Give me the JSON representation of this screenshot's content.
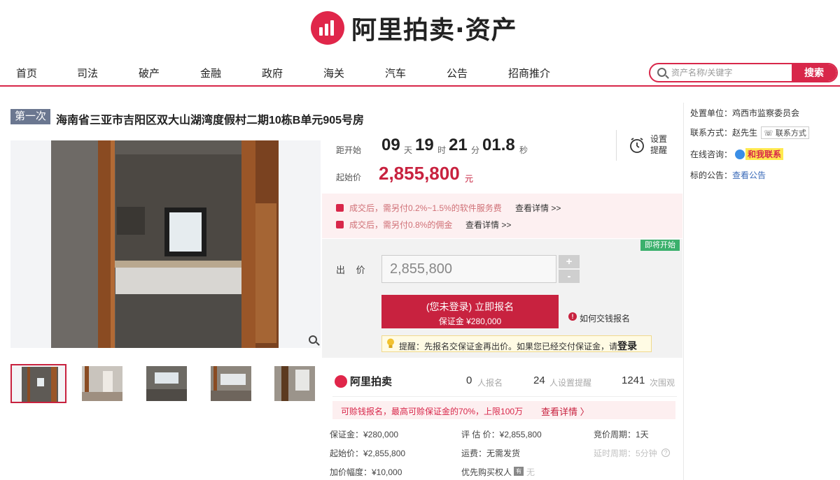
{
  "brand": {
    "logo_text": "阿里拍卖·资产",
    "accent_color": "#d8274a",
    "small_logo_text": "阿里拍卖"
  },
  "nav": {
    "items": [
      "首页",
      "司法",
      "破产",
      "金融",
      "政府",
      "海关",
      "汽车",
      "公告",
      "招商推介"
    ]
  },
  "search": {
    "placeholder": "资产名称/关键字",
    "button_label": "搜索"
  },
  "item": {
    "round": "第一次",
    "title": "海南省三亚市吉阳区双大山湖湾度假村二期10栋B单元905号房"
  },
  "countdown": {
    "label": "距开始",
    "days": "09",
    "days_unit": "天",
    "hours": "19",
    "hours_unit": "时",
    "minutes": "21",
    "minutes_unit": "分",
    "seconds": "01.8",
    "seconds_unit": "秒",
    "remind_label": "设置提醒"
  },
  "price": {
    "label": "起始价",
    "value": "2,855,800",
    "unit": "元"
  },
  "fees": [
    {
      "text": "成交后，需另付0.2%~1.5%的软件服务费",
      "link": "查看详情 >>"
    },
    {
      "text": "成交后，需另付0.8%的佣金",
      "link": "查看详情 >>"
    }
  ],
  "bid": {
    "status_badge": "即将开始",
    "label": "出 价",
    "value": "2,855,800",
    "plus": "+",
    "minus": "-",
    "signup_main": "(您未登录) 立即报名",
    "signup_sub": "保证金 ¥280,000",
    "how_link": "如何交钱报名",
    "tip_text": "提醒：先报名交保证金再出价。如果您已经交付保证金，请",
    "tip_login": "登录"
  },
  "stats": {
    "signups": "0",
    "signups_label": "人报名",
    "reminders": "24",
    "reminders_label": "人设置提醒",
    "views": "1241",
    "views_label": "次围观"
  },
  "loan": {
    "text": "可赊钱报名，最高可赊保证金的70%，上限100万",
    "link": "查看详情 〉"
  },
  "specs": {
    "deposit": "保证金：¥280,000",
    "appraisal": "评 估 价：¥2,855,800",
    "period": "竞价周期：1天",
    "start_price": "起始价：¥2,855,800",
    "shipping": "运费：无需发货",
    "delay": "延时周期：5分钟",
    "increment": "加价幅度：¥10,000",
    "priority": "优先购买权人",
    "priority_badge": "有",
    "priority_tail": "无"
  },
  "side": {
    "org_label": "处置单位：",
    "org": "鸡西市监察委员会",
    "contact_label": "联系方式：",
    "contact": "赵先生",
    "contact_btn": "联系方式",
    "online_label": "在线咨询：",
    "chat_btn": "和我联系",
    "notice_label": "标的公告：",
    "notice_link": "查看公告"
  }
}
